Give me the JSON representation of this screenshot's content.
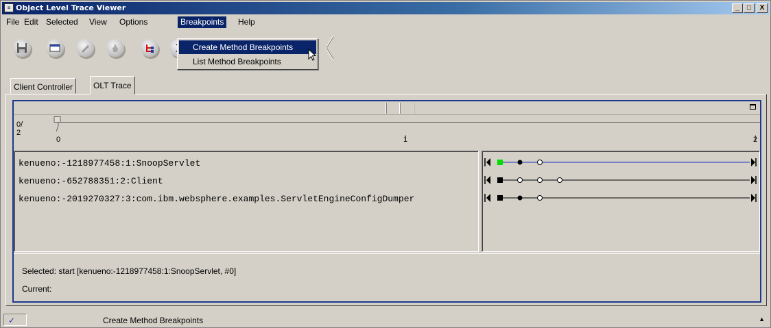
{
  "window": {
    "title": "Object Level Trace Viewer",
    "buttons": [
      "_",
      "□",
      "X"
    ]
  },
  "menubar": {
    "items": [
      {
        "label": "File"
      },
      {
        "label": "Edit"
      },
      {
        "label": "Selected"
      },
      {
        "label": "View"
      },
      {
        "label": "Options"
      },
      {
        "label": "Breakpoints"
      },
      {
        "label": "Help"
      }
    ]
  },
  "toolbar": {
    "icons": [
      "save-icon",
      "window-icon",
      "pencil-icon",
      "hand-icon",
      "tree-icon",
      "hourglass-icon"
    ]
  },
  "breakpoints_menu": {
    "items": [
      {
        "label": "Create Method Breakpoints",
        "highlighted": true
      },
      {
        "label": "List Method Breakpoints",
        "highlighted": false
      }
    ]
  },
  "tabs": [
    {
      "label": "Client Controller",
      "active": false
    },
    {
      "label": "OLT Trace",
      "active": true
    }
  ],
  "ruler": {
    "left_label_top": "0/",
    "left_label_bottom": "2",
    "ticks": [
      "0",
      "1",
      "2"
    ]
  },
  "traces": [
    {
      "label": "kenueno:-1218977458:1:SnoopServlet",
      "first_marker_color": "#00e000",
      "line_color": "#2030c0",
      "events": [
        "square",
        "filled",
        "hollow"
      ]
    },
    {
      "label": "kenueno:-652788351:2:Client",
      "first_marker_color": "#000000",
      "line_color": "#000000",
      "events": [
        "square",
        "hollow",
        "hollow",
        "hollow"
      ]
    },
    {
      "label": "kenueno:-2019270327:3:com.ibm.websphere.examples.ServletEngineConfigDumper",
      "first_marker_color": "#000000",
      "line_color": "#000000",
      "events": [
        "square",
        "filled",
        "hollow"
      ]
    }
  ],
  "status": {
    "selected": "Selected:  start [kenueno:-1218977458:1:SnoopServlet, #0]",
    "current": "Current:"
  },
  "statusbar": {
    "icon": "✓",
    "message": "Create Method Breakpoints",
    "right_glyph": "▲"
  },
  "colors": {
    "titlebar_start": "#0a246a",
    "menu_highlight": "#0a246a",
    "panel_border": "#1c3a8c"
  }
}
